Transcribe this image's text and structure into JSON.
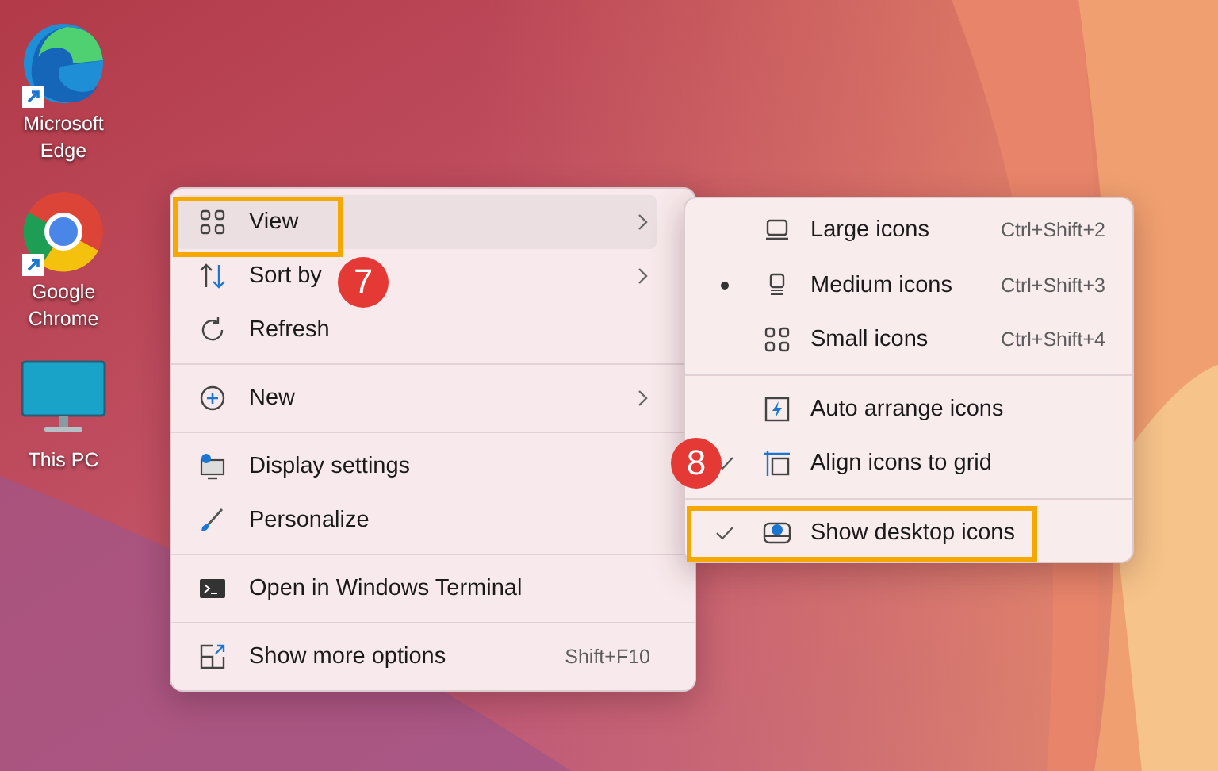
{
  "desktop_icons": [
    {
      "kind": "edge",
      "label": "Microsoft Edge",
      "shortcut": true
    },
    {
      "kind": "chrome",
      "label": "Google Chrome",
      "shortcut": true
    },
    {
      "kind": "pc",
      "label": "This PC",
      "shortcut": false
    }
  ],
  "context_menu": {
    "groups": [
      [
        {
          "kind": "view",
          "label": "View",
          "submenu": true,
          "hovered": true,
          "outlined": true
        },
        {
          "kind": "sort",
          "label": "Sort by",
          "submenu": true,
          "hovered": false,
          "badge": "7"
        },
        {
          "kind": "refresh",
          "label": "Refresh",
          "submenu": false,
          "hovered": false
        }
      ],
      [
        {
          "kind": "new",
          "label": "New",
          "submenu": true,
          "hovered": false
        }
      ],
      [
        {
          "kind": "display",
          "label": "Display settings",
          "submenu": false,
          "hovered": false
        },
        {
          "kind": "brush",
          "label": "Personalize",
          "submenu": false,
          "hovered": false
        }
      ],
      [
        {
          "kind": "terminal",
          "label": "Open in Windows Terminal",
          "submenu": false,
          "hovered": false
        }
      ],
      [
        {
          "kind": "more",
          "label": "Show more options",
          "submenu": false,
          "hovered": false,
          "shortcut": "Shift+F10"
        }
      ]
    ]
  },
  "view_submenu": {
    "groups": [
      [
        {
          "kind": "large",
          "label": "Large icons",
          "shortcut": "Ctrl+Shift+2",
          "selected": false
        },
        {
          "kind": "medium",
          "label": "Medium icons",
          "shortcut": "Ctrl+Shift+3",
          "selected": true
        },
        {
          "kind": "small",
          "label": "Small icons",
          "shortcut": "Ctrl+Shift+4",
          "selected": false
        }
      ],
      [
        {
          "kind": "arrange",
          "label": "Auto arrange icons",
          "checked": false
        },
        {
          "kind": "grid",
          "label": "Align icons to grid",
          "checked": true,
          "badge": "8"
        }
      ],
      [
        {
          "kind": "show",
          "label": "Show desktop icons",
          "checked": true,
          "outlined": true
        }
      ]
    ]
  }
}
